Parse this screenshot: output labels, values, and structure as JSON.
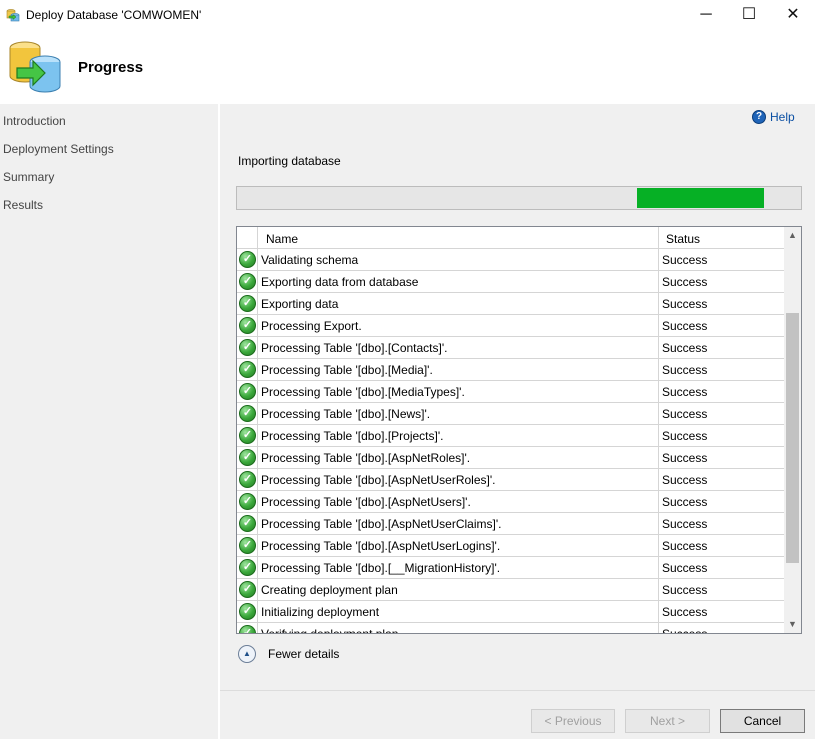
{
  "window": {
    "title": "Deploy Database 'COMWOMEN'",
    "minimize_glyph": "─",
    "maximize_glyph": "☐",
    "close_glyph": "✕"
  },
  "header": {
    "title": "Progress",
    "icon": "database-deploy-icon"
  },
  "sidebar": {
    "items": [
      {
        "label": "Introduction"
      },
      {
        "label": "Deployment Settings"
      },
      {
        "label": "Summary"
      },
      {
        "label": "Results"
      }
    ]
  },
  "main": {
    "help_label": "Help",
    "help_icon_glyph": "?",
    "status_text": "Importing database",
    "progress": {
      "state": "marquee",
      "chunk_start": 0.71,
      "chunk_end": 0.935,
      "color": "#06b025"
    },
    "grid": {
      "columns": [
        "Name",
        "Status"
      ],
      "rows": [
        {
          "name": "Validating schema",
          "status": "Success"
        },
        {
          "name": "Exporting data from database",
          "status": "Success"
        },
        {
          "name": "Exporting data",
          "status": "Success"
        },
        {
          "name": "Processing Export.",
          "status": "Success"
        },
        {
          "name": "Processing Table '[dbo].[Contacts]'.",
          "status": "Success"
        },
        {
          "name": "Processing Table '[dbo].[Media]'.",
          "status": "Success"
        },
        {
          "name": "Processing Table '[dbo].[MediaTypes]'.",
          "status": "Success"
        },
        {
          "name": "Processing Table '[dbo].[News]'.",
          "status": "Success"
        },
        {
          "name": "Processing Table '[dbo].[Projects]'.",
          "status": "Success"
        },
        {
          "name": "Processing Table '[dbo].[AspNetRoles]'.",
          "status": "Success"
        },
        {
          "name": "Processing Table '[dbo].[AspNetUserRoles]'.",
          "status": "Success"
        },
        {
          "name": "Processing Table '[dbo].[AspNetUsers]'.",
          "status": "Success"
        },
        {
          "name": "Processing Table '[dbo].[AspNetUserClaims]'.",
          "status": "Success"
        },
        {
          "name": "Processing Table '[dbo].[AspNetUserLogins]'.",
          "status": "Success"
        },
        {
          "name": "Processing Table '[dbo].[__MigrationHistory]'.",
          "status": "Success"
        },
        {
          "name": "Creating deployment plan",
          "status": "Success"
        },
        {
          "name": "Initializing deployment",
          "status": "Success"
        },
        {
          "name": "Verifying deployment plan",
          "status": "Success"
        }
      ],
      "row_icon": "success-check-icon",
      "check_glyph": "✓",
      "scroll_up_glyph": "▲",
      "scroll_down_glyph": "▼"
    },
    "fewer_details_label": "Fewer details",
    "fewer_details_glyph": "▲"
  },
  "footer": {
    "previous_label": "< Previous",
    "next_label": "Next >",
    "cancel_label": "Cancel"
  }
}
